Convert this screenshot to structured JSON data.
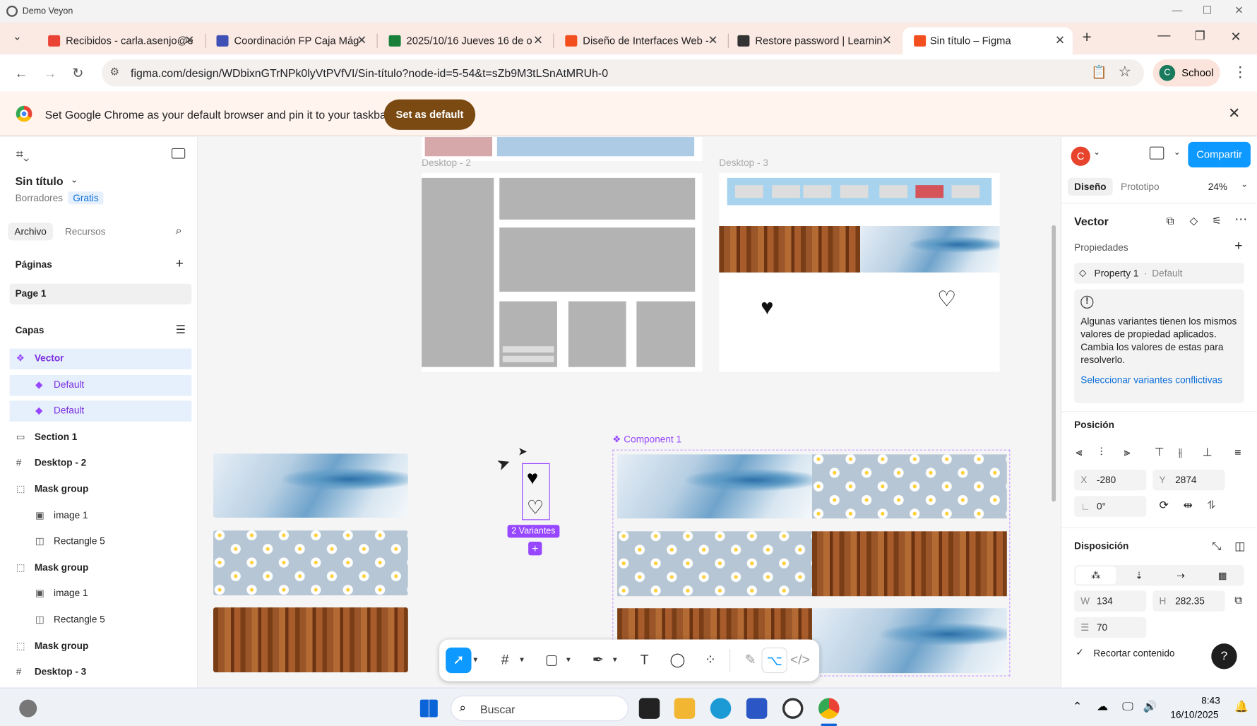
{
  "os": {
    "title": "Demo Veyon",
    "min": "—",
    "max": "☐",
    "close": "✕"
  },
  "tabs": [
    {
      "label": "Recibidos - carla.asenjo@e",
      "color": "#ea4335"
    },
    {
      "label": "Coordinación FP Caja Mág",
      "color": "#3f51b5"
    },
    {
      "label": "2025/10/16 Jueves 16 de o",
      "color": "#188038"
    },
    {
      "label": "Diseño de Interfaces Web -",
      "color": "#f24e1e"
    },
    {
      "label": "Restore password | Learnin",
      "color": "#333333"
    },
    {
      "label": "Sin título – Figma",
      "color": "#f24e1e"
    }
  ],
  "chrome": {
    "url": "figma.com/design/WDbixnGTrNPk0lyVtPVfVI/Sin-título?node-id=5-54&t=sZb9M3tLSnAtMRUh-0",
    "profile": "School",
    "profile_initial": "C"
  },
  "infobar": {
    "message": "Set Google Chrome as your default browser and pin it to your taskbar",
    "button": "Set as default"
  },
  "left": {
    "file_title": "Sin título",
    "drafts": "Borradores",
    "plan": "Gratis",
    "tab_file": "Archivo",
    "tab_assets": "Recursos",
    "pages_header": "Páginas",
    "page1": "Page 1",
    "layers_header": "Capas",
    "layers": [
      {
        "label": "Vector",
        "icon": "❖",
        "indent": 0,
        "sel": true
      },
      {
        "label": "Default",
        "icon": "◆",
        "indent": 1,
        "sel": true
      },
      {
        "label": "Default",
        "icon": "◆",
        "indent": 1,
        "sel": true
      },
      {
        "label": "Section 1",
        "icon": "▭",
        "indent": 0
      },
      {
        "label": "Desktop - 2",
        "icon": "#",
        "indent": 0
      },
      {
        "label": "Mask group",
        "icon": "⬚",
        "indent": 0
      },
      {
        "label": "image 1",
        "icon": "▣",
        "indent": 1
      },
      {
        "label": "Rectangle 5",
        "icon": "◫",
        "indent": 1
      },
      {
        "label": "Mask group",
        "icon": "⬚",
        "indent": 0
      },
      {
        "label": "image 1",
        "icon": "▣",
        "indent": 1
      },
      {
        "label": "Rectangle 5",
        "icon": "◫",
        "indent": 1
      },
      {
        "label": "Mask group",
        "icon": "⬚",
        "indent": 0
      },
      {
        "label": "Desktop - 3",
        "icon": "#",
        "indent": 0
      }
    ]
  },
  "canvas": {
    "frame_d2": "Desktop - 2",
    "frame_d3": "Desktop - 3",
    "component": "Component 1",
    "variants": "2 Variantes"
  },
  "right": {
    "avatar": "C",
    "share": "Compartir",
    "tab_design": "Diseño",
    "tab_proto": "Prototipo",
    "zoom": "24%",
    "layer_name": "Vector",
    "props": "Propiedades",
    "prop1": "Property 1",
    "prop1_val": "Default",
    "warning": "Algunas variantes tienen los mismos valores de propiedad aplicados. Cambia los valores de estas para resolverlo.",
    "fix_link": "Seleccionar variantes conflictivas",
    "position": "Posición",
    "x_label": "X",
    "x": "-280",
    "y_label": "Y",
    "y": "2874",
    "rot": "0°",
    "layout": "Disposición",
    "w_label": "W",
    "w": "134",
    "h_label": "H",
    "h": "282.35",
    "gap": "70",
    "clip": "Recortar contenido"
  },
  "taskbar": {
    "search": "Buscar",
    "time": "8:43",
    "date": "16/10/2025"
  }
}
